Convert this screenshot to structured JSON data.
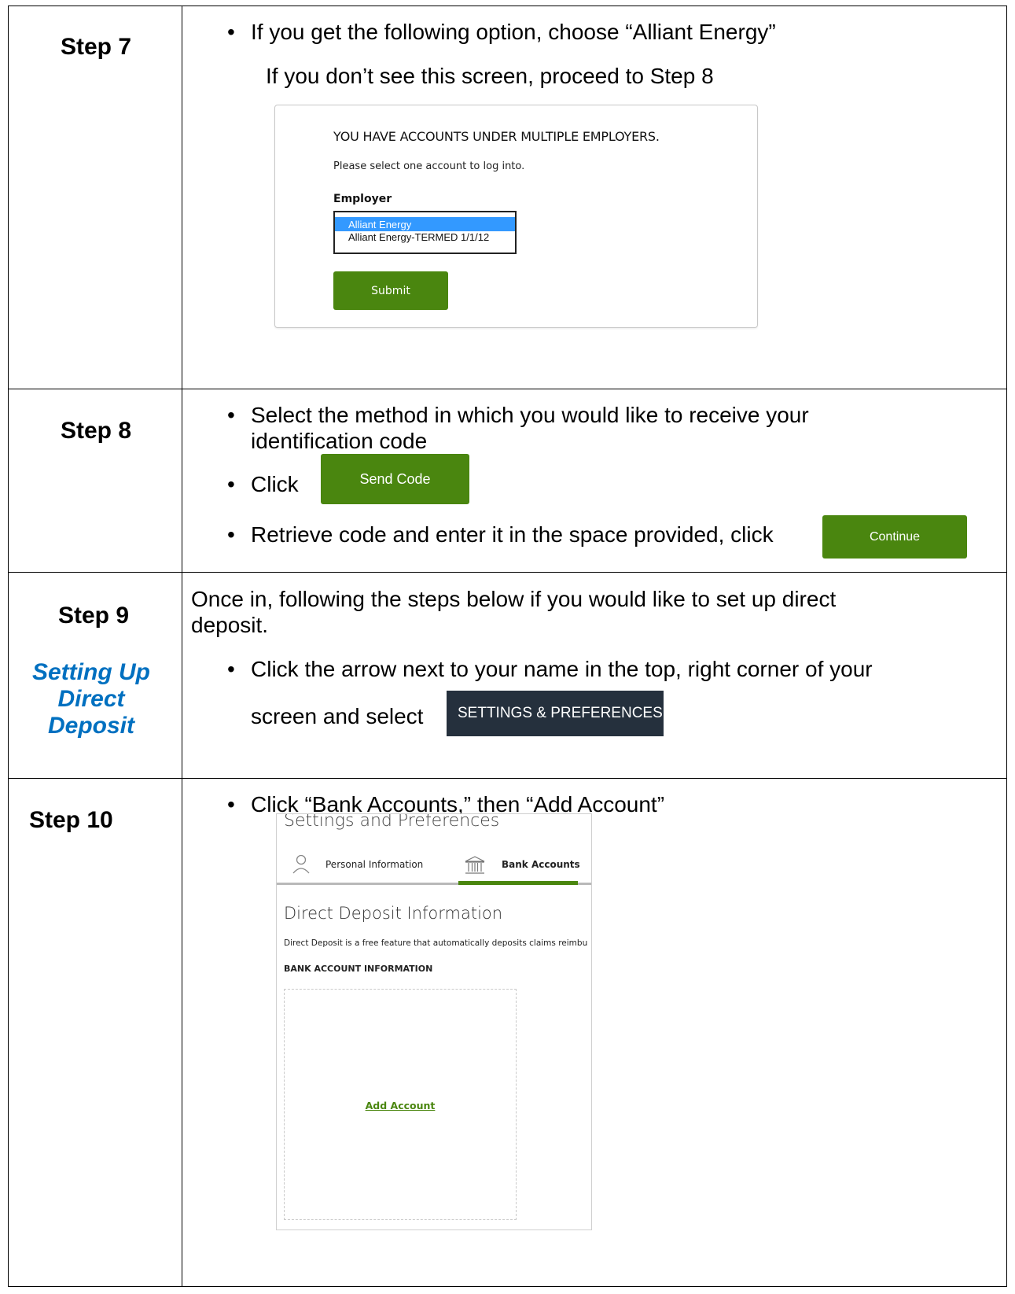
{
  "step7": {
    "title": "Step 7",
    "line1": "If you get the following option, choose “Alliant Energy”",
    "line2": "If you don’t see this screen, proceed to Step 8",
    "modal": {
      "heading": "YOU HAVE ACCOUNTS UNDER MULTIPLE EMPLOYERS.",
      "instruction": "Please select one account to log into.",
      "employer_label": "Employer",
      "options": [
        "Alliant Energy",
        "Alliant Energy-TERMED 1/1/12"
      ],
      "selected_option": "Alliant Energy",
      "submit_label": "Submit"
    }
  },
  "step8": {
    "title": "Step 8",
    "bullet1": "Select the method in which you would like to receive your identification code",
    "bullet2": "Click",
    "send_code_label": "Send Code",
    "bullet3": "Retrieve code and enter it in the space provided, click",
    "continue_label": "Continue"
  },
  "step9": {
    "title": "Step 9",
    "subtitle": "Setting Up Direct Deposit",
    "intro": "Once in, following the steps below if you would like to set up direct deposit.",
    "bullet1_line1": "Click the arrow next to your name in the top, right corner of your",
    "bullet1_line2": "screen and select",
    "settings_label": "SETTINGS & PREFERENCES"
  },
  "step10": {
    "title": "Step 10",
    "bullet1": "Click “Bank Accounts,” then “Add Account”",
    "screen": {
      "header": "Settings and Preferences",
      "tab_personal": "Personal Information",
      "tab_bank": "Bank Accounts",
      "section_title": "Direct Deposit Information",
      "description": "Direct Deposit is a free feature that automatically deposits claims reimbu",
      "bank_label": "BANK ACCOUNT INFORMATION",
      "add_account": "Add Account"
    }
  },
  "colors": {
    "green_button": "#4a860f",
    "select_highlight": "#3399ff",
    "settings_bg": "#25303d",
    "subtitle_blue": "#0070c0",
    "tab_underline": "#4a860f"
  }
}
